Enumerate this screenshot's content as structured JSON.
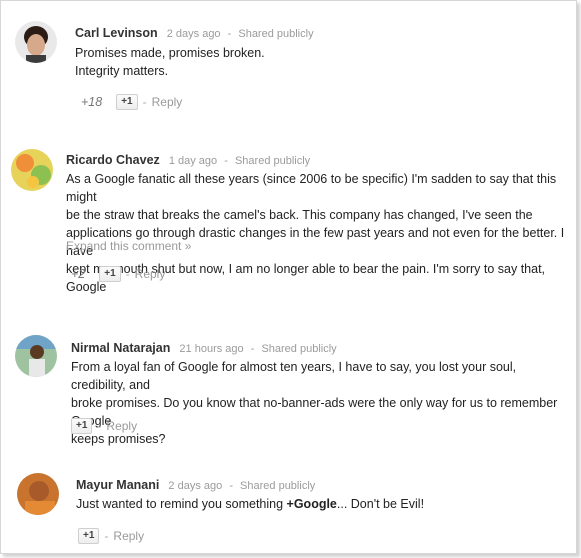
{
  "comments": [
    {
      "author": "Carl Levinson",
      "time": "2 days ago",
      "visibility": "Shared publicly",
      "lines": [
        "Promises made, promises broken.",
        "Integrity matters."
      ],
      "plus_count": "+18",
      "plus_button": "+1",
      "reply": "Reply"
    },
    {
      "author": "Ricardo Chavez",
      "time": "1 day ago",
      "visibility": "Shared publicly",
      "lines": [
        "As a Google fanatic all these years (since 2006 to be specific) I'm sadden to say that this might",
        "be the straw that breaks the camel's back. This company has changed, I've seen the",
        "applications go through drastic changes in the few past years and not even for the better. I have",
        "kept my mouth shut but now, I am no longer able to bear the pain. I'm sorry to say that, Google"
      ],
      "expand": "Expand this comment »",
      "plus_count": "+2",
      "plus_button": "+1",
      "reply": "Reply"
    },
    {
      "author": "Nirmal Natarajan",
      "time": "21 hours ago",
      "visibility": "Shared publicly",
      "lines": [
        "From a loyal fan of Google for almost ten years, I have to say, you lost your soul, credibility, and",
        "broke promises. Do you know that no-banner-ads were the only way for us to remember Google",
        "keeps promises?"
      ],
      "plus_button": "+1",
      "reply": "Reply"
    },
    {
      "author": "Mayur Manani",
      "time": "2 days ago",
      "visibility": "Shared publicly",
      "text_before": "Just wanted to remind you something ",
      "mention": "+Google",
      "text_after": "... Don't be Evil!",
      "plus_button": "+1",
      "reply": "Reply"
    }
  ],
  "colors": {
    "meta": "#9b9b9b",
    "author": "#333333",
    "text": "#222222"
  },
  "separator": "-"
}
